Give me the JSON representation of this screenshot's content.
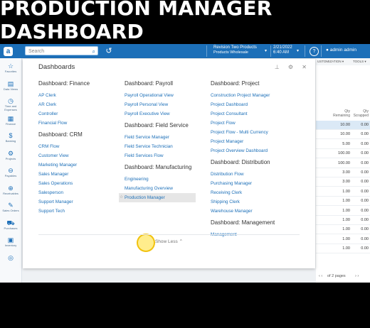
{
  "headline": "PRODUCTION MANAGER DASHBOARD",
  "topbar": {
    "search_placeholder": "Search",
    "company_line1": "Revision Two Products",
    "company_line2": "Products Wholesale",
    "date": "2/21/2022",
    "time": "6:40 AM",
    "user": "admin admin"
  },
  "sidebar": [
    {
      "icon": "☆",
      "label": "Favorites"
    },
    {
      "icon": "▤",
      "label": "Data Views"
    },
    {
      "icon": "◷",
      "label": "Time and Expenses"
    },
    {
      "icon": "▦",
      "label": "Finance"
    },
    {
      "icon": "$",
      "label": "Banking"
    },
    {
      "icon": "⚙",
      "label": "Projects"
    },
    {
      "icon": "⊖",
      "label": "Payables"
    },
    {
      "icon": "⊕",
      "label": "Receivables"
    },
    {
      "icon": "✎",
      "label": "Sales Orders"
    },
    {
      "icon": "⛟",
      "label": "Purchases"
    },
    {
      "icon": "▣",
      "label": "Inventory"
    },
    {
      "icon": "◎",
      "label": ""
    }
  ],
  "background": {
    "header_left": "USTOMIZATION ▾",
    "header_right": "TOOLS ▾",
    "col1": "Qty Remaining",
    "col2": "Qty Scrapped",
    "rows": [
      [
        "10.00",
        "0.00"
      ],
      [
        "10.00",
        "0.00"
      ],
      [
        "5.00",
        "0.00"
      ],
      [
        "100.00",
        "0.00"
      ],
      [
        "100.00",
        "0.00"
      ],
      [
        "3.00",
        "0.00"
      ],
      [
        "3.00",
        "0.00"
      ],
      [
        "1.00",
        "0.00"
      ],
      [
        "1.00",
        "0.00"
      ],
      [
        "1.00",
        "0.00"
      ],
      [
        "1.00",
        "0.00"
      ],
      [
        "1.00",
        "0.00"
      ],
      [
        "1.00",
        "0.00"
      ],
      [
        "1.00",
        "0.00"
      ]
    ],
    "pager": "of 2 pages"
  },
  "panel": {
    "title": "Dashboards",
    "show_less": "Show Less ⌃",
    "columns": [
      [
        {
          "title": "Dashboard: Finance",
          "links": [
            "AP Clerk",
            "AR Clerk",
            "Controller",
            "Financial Flow"
          ]
        },
        {
          "title": "Dashboard: CRM",
          "links": [
            "CRM Flow",
            "Customer View",
            "Marketing Manager",
            "Sales Manager",
            "Sales Operations",
            "Salesperson",
            "Support Manager",
            "Support Tech"
          ]
        }
      ],
      [
        {
          "title": "Dashboard: Payroll",
          "links": [
            "Payroll Operational View",
            "Payroll Personal View",
            "Payroll Executive View"
          ]
        },
        {
          "title": "Dashboard: Field Service",
          "links": [
            "Field Service Manager",
            "Field Service Technician",
            "Field Services Flow"
          ]
        },
        {
          "title": "Dashboard: Manufacturing",
          "links": [
            "Engineering",
            "Manufacturing Overview",
            "Production Manager"
          ]
        }
      ],
      [
        {
          "title": "Dashboard: Project",
          "links": [
            "Construction Project Manager",
            "Project Dashboard",
            "Project Consultant",
            "Project Flow",
            "Project Flow - Multi Currency",
            "Project Manager",
            "Project Overview Dashboard"
          ]
        },
        {
          "title": "Dashboard: Distribution",
          "links": [
            "Distribution Flow",
            "Purchasing Manager",
            "Receiving Clerk",
            "Shipping Clerk",
            "Warehouse Manager"
          ]
        },
        {
          "title": "Dashboard: Management",
          "links": [
            "Management"
          ]
        }
      ]
    ]
  }
}
